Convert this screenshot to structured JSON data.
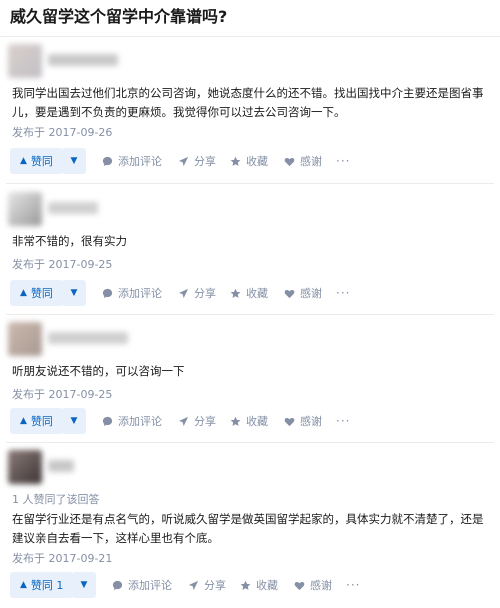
{
  "question": {
    "title": "威久留学这个留学中介靠谱吗?"
  },
  "actions_labels": {
    "vote_up": "赞同",
    "comment": "添加评论",
    "share": "分享",
    "favorite": "收藏",
    "thanks": "感谢",
    "more": "···"
  },
  "colors": {
    "accent": "#0a66c2",
    "accent_bg": "#e8f1fb",
    "muted": "#8590a6",
    "divider": "#ebebeb"
  },
  "answers": [
    {
      "text": "我同学出国去过他们北京的公司咨询，她说态度什么的还不错。找出国找中介主要还是图省事儿，要是遇到不负责的更麻烦。我觉得你可以过去公司咨询一下。",
      "date": "发布于 2017-09-26",
      "vote_label": "赞同",
      "vote_summary": ""
    },
    {
      "text": "非常不错的，很有实力",
      "date": "发布于 2017-09-25",
      "vote_label": "赞同",
      "vote_summary": ""
    },
    {
      "text": "听朋友说还不错的，可以咨询一下",
      "date": "发布于 2017-09-25",
      "vote_label": "赞同",
      "vote_summary": ""
    },
    {
      "text": "在留学行业还是有点名气的，听说威久留学是做英国留学起家的，具体实力就不清楚了，还是建议亲自去看一下，这样心里也有个底。",
      "date": "发布于 2017-09-21",
      "vote_label": "赞同 1",
      "vote_summary": "1 人赞同了该回答"
    }
  ]
}
